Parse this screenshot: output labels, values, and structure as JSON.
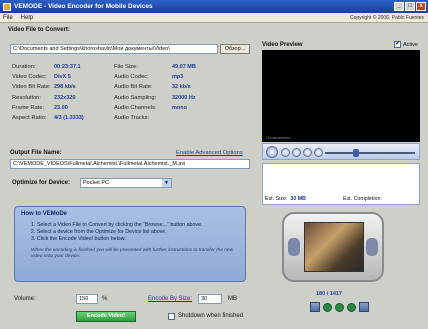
{
  "window": {
    "title": "VEMODE - Video Encoder for Mobile Devices",
    "min": "_",
    "max": "□",
    "close": "x"
  },
  "menu": {
    "file": "File",
    "help": "Help",
    "copyright": "Copyright © 2006, Pablo Fuentes"
  },
  "input": {
    "label": "Video File to Convert:",
    "path": "C:\\Documents and Settings\\khoroshavin\\Мои документы\\Video\\",
    "browse": "Обзор..."
  },
  "info": [
    {
      "k": "Duration:",
      "v": "00:23:37.1",
      "k2": "File Size:",
      "v2": "49.07 MB"
    },
    {
      "k": "Video Codec:",
      "v": "DivX 5",
      "k2": "Audio Codec:",
      "v2": "mp3"
    },
    {
      "k": "Video Bit Rate:",
      "v": "298 kb/s",
      "k2": "Audio Bit Rate:",
      "v2": "32 kb/s"
    },
    {
      "k": "Resolution:",
      "v": "232x320",
      "k2": "Audio Sampling:",
      "v2": "32000 Hz"
    },
    {
      "k": "Frame Rate:",
      "v": "23.00",
      "k2": "Audio Channels:",
      "v2": "mono"
    },
    {
      "k": "Aspect Ratio:",
      "v": "4/3 (1.3333)",
      "k2": "Audio Tracks:",
      "v2": ""
    }
  ],
  "output": {
    "label": "Output File Name:",
    "advanced": "Enable Advanced Options",
    "path": "C:\\VEMODE_VIDEOS\\Fullmetal.Alchemist.\\Fullmetal.Alchemist._M.avi"
  },
  "optimize": {
    "label": "Optimize for Device:",
    "value": "Pocket PC"
  },
  "howto": {
    "title": "How to VEMoDe",
    "steps": [
      "1. Select a Video File to Convert by clicking the \"Browse...\" button above.",
      "2. Select a device from the Optimize for Device list above.",
      "3. Click the Encode Video! button below."
    ],
    "note": "When the encoding is finished you will be presented with further instructions to transfer the new video onto your device."
  },
  "volume": {
    "label": "Volume:",
    "value": "150",
    "unit": "%"
  },
  "bysize": {
    "label": "Encode By Size:",
    "value": "30",
    "unit": "MB"
  },
  "encode_label": "Encode Video!",
  "shutdown_label": "Shutdown when finished",
  "preview": {
    "label": "Video Preview",
    "active_label": "Active",
    "active_check": "✔",
    "caption": "Остановлено",
    "est_size_label": "Est. Size:",
    "est_size_value": "30 MB",
    "est_completion_label": "Est. Completion:",
    "frame_counter": "180 / 1417"
  }
}
